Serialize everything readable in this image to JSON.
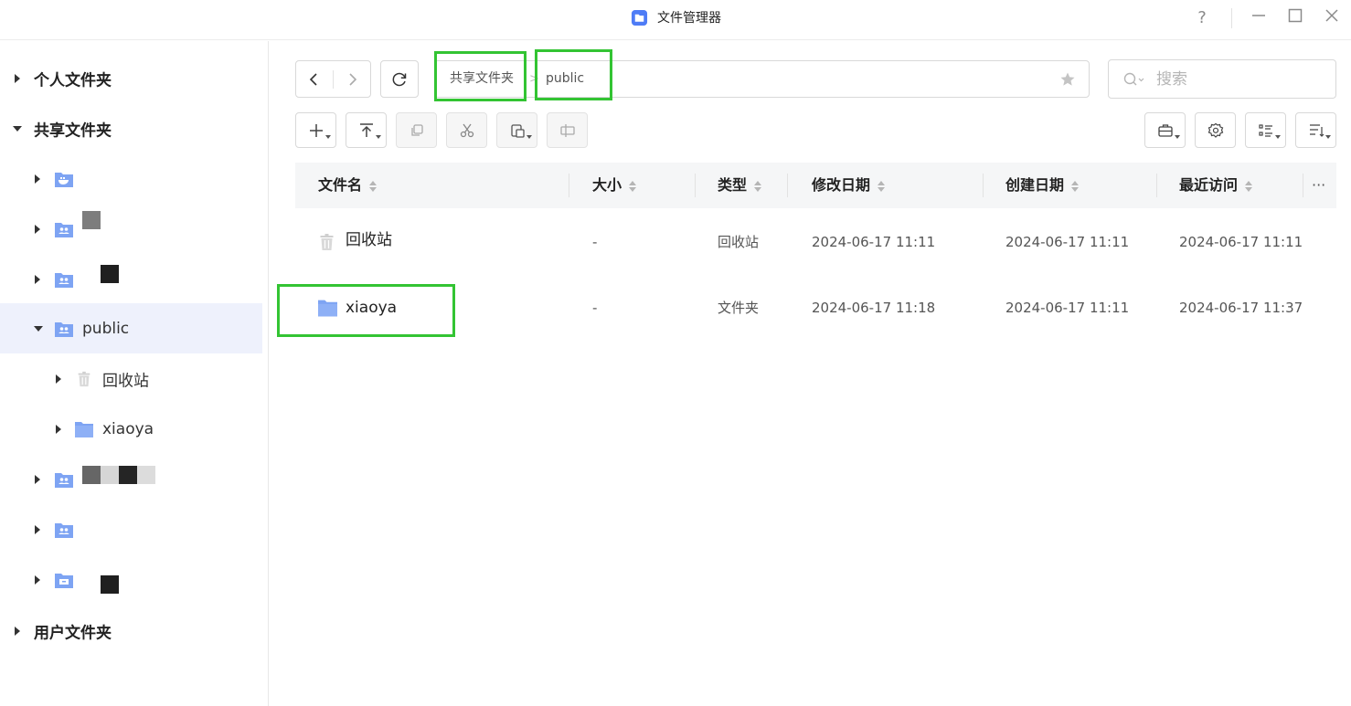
{
  "window": {
    "title": "文件管理器",
    "controls": {
      "help": "?",
      "minimize": "—",
      "maximize": "☐",
      "close": "✕"
    }
  },
  "sidebar": {
    "personal": "个人文件夹",
    "shared": "共享文件夹",
    "public": "public",
    "recycle": "回收站",
    "xiaoya": "xiaoya",
    "user": "用户文件夹"
  },
  "toolbar": {
    "new_icon": "plus-icon",
    "upload_icon": "upload-icon",
    "copy_icon": "copy-icon",
    "cut_icon": "cut-icon",
    "paste_icon": "paste-icon",
    "rename_icon": "rename-icon"
  },
  "path": {
    "crumbs": [
      "共享文件夹",
      "public"
    ],
    "separator": ">"
  },
  "search": {
    "placeholder": "搜索"
  },
  "table": {
    "headers": {
      "name": "文件名",
      "size": "大小",
      "type": "类型",
      "modified": "修改日期",
      "created": "创建日期",
      "accessed": "最近访问",
      "more": "···"
    },
    "rows": [
      {
        "name": "回收站",
        "size": "-",
        "type": "回收站",
        "modified": "2024-06-17 11:11",
        "created": "2024-06-17 11:11",
        "accessed": "2024-06-17 11:11"
      },
      {
        "name": "xiaoya",
        "size": "-",
        "type": "文件夹",
        "modified": "2024-06-17 11:18",
        "created": "2024-06-17 11:11",
        "accessed": "2024-06-17 11:37"
      }
    ]
  },
  "colors": {
    "accent": "#4e7cf6",
    "folder": "#7ea4f3",
    "highlight": "#33c433",
    "selected_row": "#eef1fc"
  }
}
